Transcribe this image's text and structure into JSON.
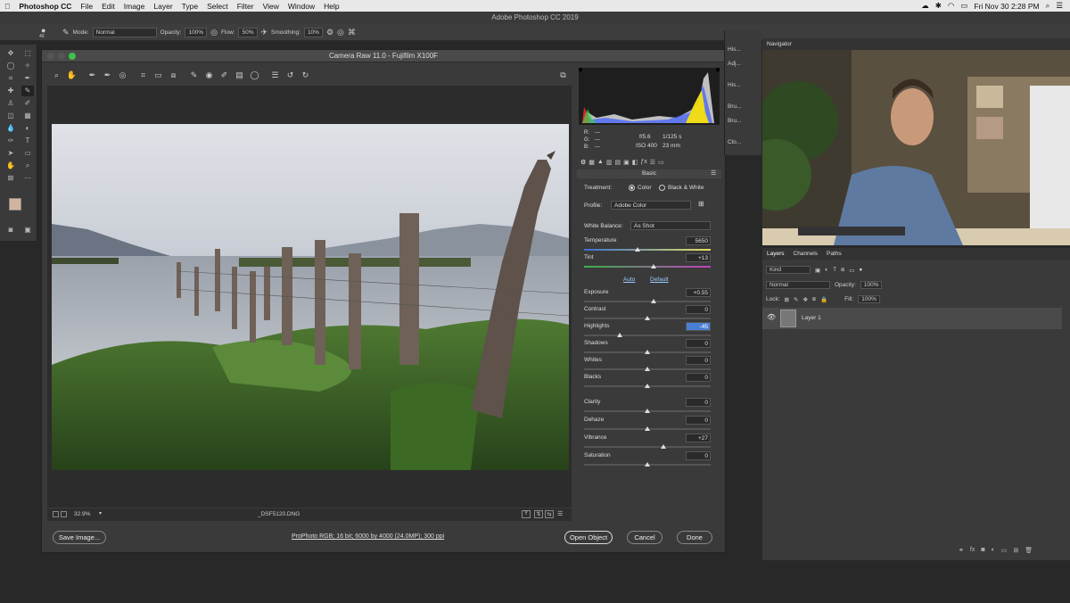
{
  "menubar": {
    "app": "Photoshop CC",
    "items": [
      "File",
      "Edit",
      "Image",
      "Layer",
      "Type",
      "Select",
      "Filter",
      "View",
      "Window",
      "Help"
    ],
    "clock": "Fri Nov 30  2:28 PM"
  },
  "ps_title": "Adobe Photoshop CC 2019",
  "options": {
    "brush_size": "49",
    "mode_label": "Mode:",
    "mode": "Normal",
    "opacity_label": "Opacity:",
    "opacity": "100%",
    "flow_label": "Flow:",
    "flow": "50%",
    "smoothing_label": "Smoothing:",
    "smoothing": "10%"
  },
  "camera_raw": {
    "title": "Camera Raw 11.0  -  Fujifilm X100F",
    "zoom": "32.9%",
    "filename": "_DSF5120.DNG",
    "save_label": "Save Image...",
    "workflow": "ProPhoto RGB; 16 bit; 6000 by 4000 (24.0MP); 300 ppi",
    "open_label": "Open Object",
    "cancel_label": "Cancel",
    "done_label": "Done",
    "info": {
      "r": "R:",
      "g": "G:",
      "b": "B:",
      "dash": "---",
      "aperture": "f/5.6",
      "shutter": "1/125 s",
      "iso": "ISO 400",
      "focal": "23 mm"
    },
    "panel_title": "Basic",
    "treatment_label": "Treatment:",
    "color_label": "Color",
    "bw_label": "Black & White",
    "profile_label": "Profile:",
    "profile": "Adobe Color",
    "wb_label": "White Balance:",
    "wb": "As Shot",
    "auto_label": "Auto",
    "default_label": "Default",
    "sliders": [
      {
        "name": "Temperature",
        "value": "5650",
        "pos": 0.42
      },
      {
        "name": "Tint",
        "value": "+13",
        "pos": 0.55
      },
      {
        "name": "Exposure",
        "value": "+0.55",
        "pos": 0.55
      },
      {
        "name": "Contrast",
        "value": "0",
        "pos": 0.5
      },
      {
        "name": "Highlights",
        "value": "-45",
        "pos": 0.28
      },
      {
        "name": "Shadows",
        "value": "0",
        "pos": 0.5
      },
      {
        "name": "Whites",
        "value": "0",
        "pos": 0.5
      },
      {
        "name": "Blacks",
        "value": "0",
        "pos": 0.5
      },
      {
        "name": "Clarity",
        "value": "0",
        "pos": 0.5
      },
      {
        "name": "Dehaze",
        "value": "0",
        "pos": 0.5
      },
      {
        "name": "Vibrance",
        "value": "+27",
        "pos": 0.63
      },
      {
        "name": "Saturation",
        "value": "0",
        "pos": 0.5
      }
    ]
  },
  "side_icons": [
    "His...",
    "Adj...",
    "His...",
    "Bru...",
    "Bru...",
    "Clo..."
  ],
  "navigator": {
    "tab": "Navigator"
  },
  "layers": {
    "tabs": [
      "Layers",
      "Channels",
      "Paths"
    ],
    "kind": "Kind",
    "blend": "Normal",
    "opacity_label": "Opacity:",
    "opacity": "100%",
    "lock_label": "Lock:",
    "fill_label": "Fill:",
    "fill": "100%",
    "layer_name": "Layer 1"
  },
  "colors": {
    "accent": "#4a7fd6",
    "panel": "#3a3a3a"
  }
}
